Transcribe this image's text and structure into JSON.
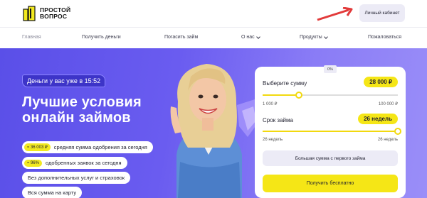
{
  "header": {
    "logo_text": "ПРОСТОЙ ВОПРОС",
    "cabinet_button": "Личный кабинет"
  },
  "nav": {
    "items": [
      {
        "label": "Главная"
      },
      {
        "label": "Получить деньги"
      },
      {
        "label": "Погасить займ"
      },
      {
        "label": "О нас"
      },
      {
        "label": "Продукты"
      },
      {
        "label": "Пожаловаться"
      }
    ]
  },
  "hero": {
    "badge": "Деньги у вас уже в 15:52",
    "title_line1": "Лучшие условия",
    "title_line2": "онлайн займов",
    "features": [
      {
        "pill": "≈ 36 003 ₽",
        "text": "средняя сумма одобрения за сегодня"
      },
      {
        "pill": "≈ 96%",
        "text": "одобренных заявок за сегодня"
      },
      {
        "pill": "",
        "text": "Без дополнительных услуг и страховок"
      },
      {
        "pill": "",
        "text": "Вся сумма на карту"
      }
    ]
  },
  "calculator": {
    "percent_tag": "0%",
    "amount_label": "Выберите сумму",
    "amount_value": "28 000 ₽",
    "amount_min": "1 000 ₽",
    "amount_max": "100 000 ₽",
    "amount_fraction": 0.27,
    "term_label": "Срок займа",
    "term_value": "26 недель",
    "term_min": "26 недель",
    "term_max": "26 недель",
    "term_fraction": 1.0,
    "secondary_button": "Большая сумма с первого займа",
    "primary_button": "Получить бесплатно"
  },
  "colors": {
    "accent_yellow": "#f5e616",
    "hero_purple": "#5a4fe8",
    "arrow_red": "#e23a3a"
  }
}
